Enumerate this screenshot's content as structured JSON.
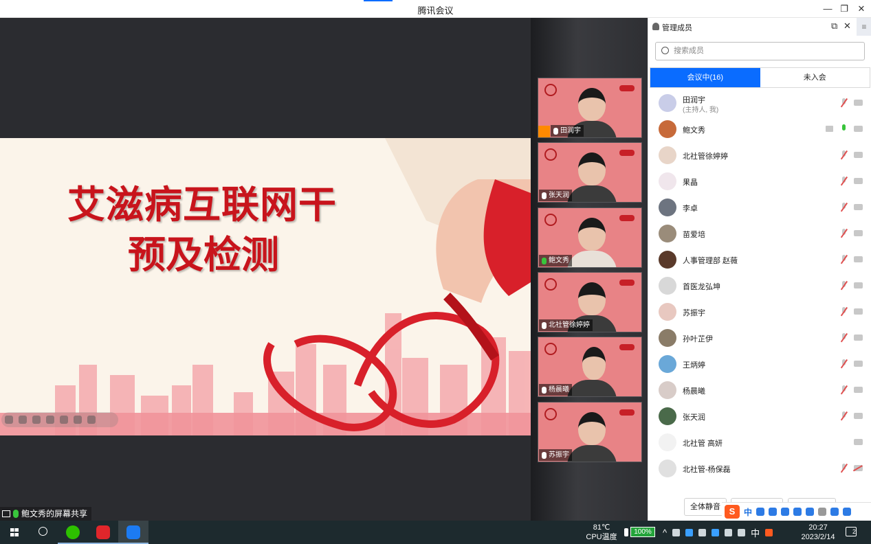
{
  "window": {
    "title": "腾讯会议",
    "minimize_icon": "minimize-icon",
    "restore_icon": "restore-icon",
    "close_icon": "close-icon"
  },
  "slide": {
    "title_line1": "艾滋病互联网干",
    "title_line2": "预及检测",
    "colors": {
      "title": "#c8141c",
      "background": "#fbf4ea",
      "ribbon": "#d8202a"
    }
  },
  "share_label": "鲍文秀的屏幕共享",
  "video_tiles": [
    {
      "name": "田润宇",
      "mic": "muted",
      "host": true
    },
    {
      "name": "张天润",
      "mic": "muted",
      "host": false
    },
    {
      "name": "鲍文秀",
      "mic": "live",
      "host": false
    },
    {
      "name": "北社管徐婷婷",
      "mic": "muted",
      "host": false
    },
    {
      "name": "杨晨曦",
      "mic": "muted",
      "host": false
    },
    {
      "name": "苏振宇",
      "mic": "muted",
      "host": false
    }
  ],
  "panel": {
    "title": "管理成员",
    "search_placeholder": "搜索成员",
    "tabs": [
      {
        "label": "会议中(16)",
        "active": true
      },
      {
        "label": "未入会",
        "active": false
      }
    ],
    "members": [
      {
        "name": "田润宇",
        "sub": "(主持人, 我)",
        "mic": "muted",
        "cam": "on",
        "screen": false,
        "avatar_color": "#c9cde8"
      },
      {
        "name": "鲍文秀",
        "sub": "",
        "mic": "live",
        "cam": "on",
        "screen": true,
        "avatar_color": "#c76a3a"
      },
      {
        "name": "北社管徐婷婷",
        "sub": "",
        "mic": "muted",
        "cam": "on",
        "screen": false,
        "avatar_color": "#e8d5c8"
      },
      {
        "name": "果晶",
        "sub": "",
        "mic": "muted",
        "cam": "on",
        "screen": false,
        "avatar_color": "#f0e6ec"
      },
      {
        "name": "李卓",
        "sub": "",
        "mic": "muted",
        "cam": "on",
        "screen": false,
        "avatar_color": "#6d7480"
      },
      {
        "name": "苗爱培",
        "sub": "",
        "mic": "muted",
        "cam": "on",
        "screen": false,
        "avatar_color": "#9a8c7a"
      },
      {
        "name": "人事管理部 赵薇",
        "sub": "",
        "mic": "muted",
        "cam": "on",
        "screen": false,
        "avatar_color": "#5a3a2a"
      },
      {
        "name": "首医龙弘坤",
        "sub": "",
        "mic": "muted",
        "cam": "on",
        "screen": false,
        "avatar_color": "#d8d8d8"
      },
      {
        "name": "苏振宇",
        "sub": "",
        "mic": "muted",
        "cam": "on",
        "screen": false,
        "avatar_color": "#e8c8c0"
      },
      {
        "name": "孙叶芷伊",
        "sub": "",
        "mic": "muted",
        "cam": "on",
        "screen": false,
        "avatar_color": "#8a7c68"
      },
      {
        "name": "王炳婷",
        "sub": "",
        "mic": "muted",
        "cam": "on",
        "screen": false,
        "avatar_color": "#6aa8d8"
      },
      {
        "name": "杨晨曦",
        "sub": "",
        "mic": "muted",
        "cam": "on",
        "screen": false,
        "avatar_color": "#d8ccc8"
      },
      {
        "name": "张天润",
        "sub": "",
        "mic": "muted",
        "cam": "on",
        "screen": false,
        "avatar_color": "#4a6a4a"
      },
      {
        "name": "北社管 高妍",
        "sub": "",
        "mic": "none",
        "cam": "on",
        "screen": false,
        "avatar_color": "#f2f2f2"
      },
      {
        "name": "北社管-杨保磊",
        "sub": "",
        "mic": "muted",
        "cam": "off",
        "screen": false,
        "avatar_color": "#e0e0e0"
      }
    ],
    "mute_all_button": "全体静音"
  },
  "ime": {
    "logo": "S",
    "mode": "中"
  },
  "taskbar": {
    "cpu_temp": "81℃",
    "cpu_label": "CPU温度",
    "battery": "100%",
    "ime_char": "中",
    "time": "20:27",
    "date": "2023/2/14",
    "notifications": "2",
    "apps": [
      "start-icon",
      "search-icon",
      "wechat-icon",
      "wps-icon",
      "tencent-meeting-icon"
    ]
  }
}
